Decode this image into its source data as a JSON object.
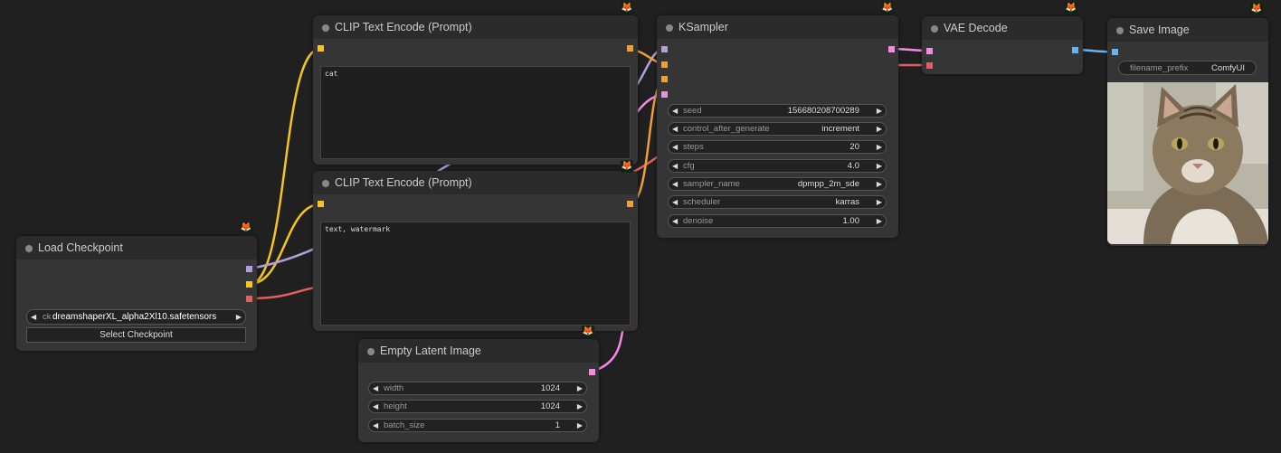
{
  "colors": {
    "canvas_bg": "#202020",
    "node_bg": "#353535",
    "node_title_bg": "#2b2b2b",
    "clip_slot": "#f5c51c",
    "model_slot": "#b39ddb",
    "vae_slot": "#e06060",
    "conditioning_slot": "#f0a030",
    "latent_slot": "#f38ae4",
    "image_slot": "#64b5f6"
  },
  "nodes": {
    "load_checkpoint": {
      "title": "Load Checkpoint",
      "ckpt_label": "ck",
      "ckpt_value": "dreamshaperXL_alpha2Xl10.safetensors",
      "button": "Select Checkpoint"
    },
    "clip_positive": {
      "title": "CLIP Text Encode (Prompt)",
      "text": "cat"
    },
    "clip_negative": {
      "title": "CLIP Text Encode (Prompt)",
      "text": "text, watermark"
    },
    "empty_latent": {
      "title": "Empty Latent Image",
      "widgets": [
        {
          "label": "width",
          "value": "1024"
        },
        {
          "label": "height",
          "value": "1024"
        },
        {
          "label": "batch_size",
          "value": "1"
        }
      ]
    },
    "ksampler": {
      "title": "KSampler",
      "widgets": [
        {
          "label": "seed",
          "value": "156680208700289"
        },
        {
          "label": "control_after_generate",
          "value": "increment"
        },
        {
          "label": "steps",
          "value": "20"
        },
        {
          "label": "cfg",
          "value": "4.0"
        },
        {
          "label": "sampler_name",
          "value": "dpmpp_2m_sde"
        },
        {
          "label": "scheduler",
          "value": "karras"
        },
        {
          "label": "denoise",
          "value": "1.00"
        }
      ]
    },
    "vae_decode": {
      "title": "VAE Decode"
    },
    "save_image": {
      "title": "Save Image",
      "prefix_label": "filename_prefix",
      "prefix_value": "ComfyUI",
      "image_icon": "cat-photo"
    }
  }
}
